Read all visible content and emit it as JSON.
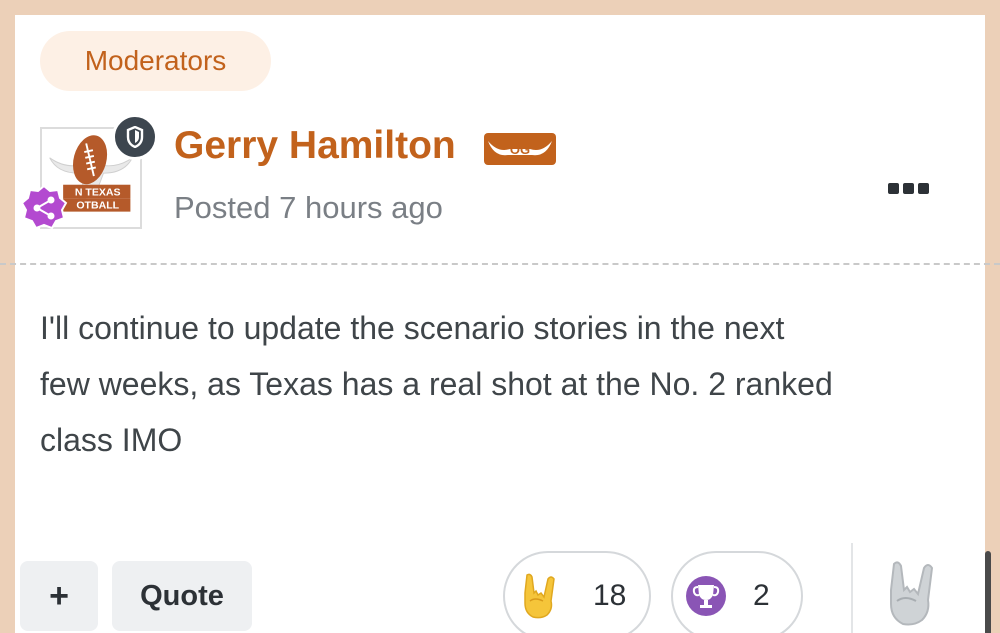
{
  "group": {
    "label": "Moderators"
  },
  "author": {
    "name": "Gerry Hamilton",
    "badge_text": "OG",
    "avatar_text": [
      "N TEXAS",
      "OTBALL"
    ],
    "posted": "Posted 7 hours ago"
  },
  "post": {
    "lines": [
      "I'll continue to update the scenario stories in the next",
      "few weeks, as Texas has a real shot at the No. 2 ranked",
      "class IMO"
    ]
  },
  "actions": {
    "plus_label": "+",
    "quote_label": "Quote"
  },
  "reactions": [
    {
      "icon": "rock-on-hand-icon",
      "count": "18"
    },
    {
      "icon": "trophy-icon",
      "count": "2"
    }
  ],
  "colors": {
    "accent": "#c2621c",
    "page_bg": "#ecd0b8",
    "text": "#3f4549",
    "muted": "#7a7f85",
    "share_badge": "#b34ad0",
    "trophy_badge": "#8a55b5"
  }
}
